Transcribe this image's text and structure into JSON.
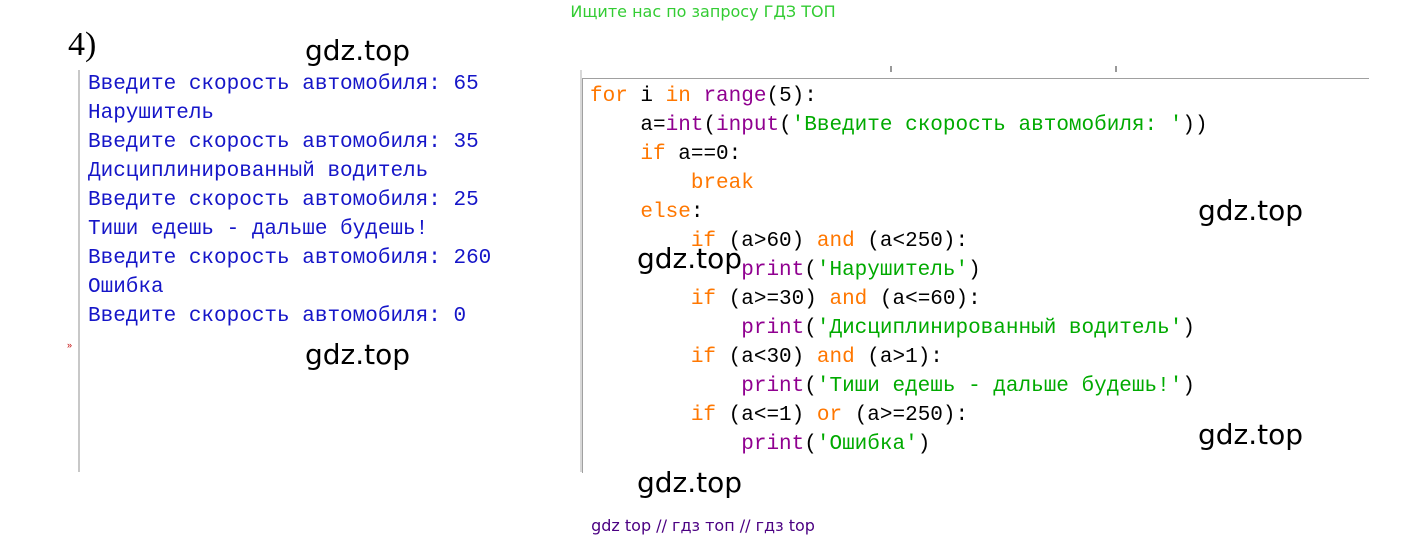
{
  "top_banner": "Ищите нас по запросу ГДЗ ТОП",
  "task_number": "4)",
  "watermark": "gdz.top",
  "shell": {
    "lines": [
      {
        "prompt": "Введите скорость автомобиля: ",
        "input": "65"
      },
      {
        "output": "Нарушитель"
      },
      {
        "prompt": "Введите скорость автомобиля: ",
        "input": "35"
      },
      {
        "output": "Дисциплинированный водитель"
      },
      {
        "prompt": "Введите скорость автомобиля: ",
        "input": "25"
      },
      {
        "output": "Тиши едешь - дальше будешь!"
      },
      {
        "prompt": "Введите скорость автомобиля: ",
        "input": "260"
      },
      {
        "output": "Ошибка"
      },
      {
        "prompt": "Введите скорость автомобиля: ",
        "input": "0"
      }
    ]
  },
  "code": {
    "line1": {
      "kw1": "for",
      "t1": " i ",
      "kw2": "in",
      "t2": " ",
      "bi": "range",
      "t3": "(5):"
    },
    "line2": {
      "t1": "    a=",
      "bi1": "int",
      "t2": "(",
      "bi2": "input",
      "t3": "(",
      "st": "'Введите скорость автомобиля: '",
      "t4": "))"
    },
    "line3": {
      "t1": "    ",
      "kw": "if",
      "t2": " a==0:"
    },
    "line4": {
      "t1": "        ",
      "kw": "break"
    },
    "line5": {
      "t1": "    ",
      "kw": "else",
      "t2": ":"
    },
    "line6": {
      "t1": "        ",
      "kw1": "if",
      "t2": " (a>60) ",
      "kw2": "and",
      "t3": " (a<250):"
    },
    "line7": {
      "t1": "            ",
      "bi": "print",
      "t2": "(",
      "st": "'Нарушитель'",
      "t3": ")"
    },
    "line8": {
      "t1": "        ",
      "kw1": "if",
      "t2": " (a>=30) ",
      "kw2": "and",
      "t3": " (a<=60):"
    },
    "line9": {
      "t1": "            ",
      "bi": "print",
      "t2": "(",
      "st": "'Дисциплинированный водитель'",
      "t3": ")"
    },
    "line10": {
      "t1": "        ",
      "kw1": "if",
      "t2": " (a<30) ",
      "kw2": "and",
      "t3": " (a>1):"
    },
    "line11": {
      "t1": "            ",
      "bi": "print",
      "t2": "(",
      "st": "'Тиши едешь - дальше будешь!'",
      "t3": ")"
    },
    "line12": {
      "t1": "        ",
      "kw1": "if",
      "t2": " (a<=1) ",
      "kw2": "or",
      "t3": " (a>=250):"
    },
    "line13": {
      "t1": "            ",
      "bi": "print",
      "t2": "(",
      "st": "'Ошибка'",
      "t3": ")"
    }
  },
  "footer": "gdz top  //  гдз топ  //  гдз top"
}
